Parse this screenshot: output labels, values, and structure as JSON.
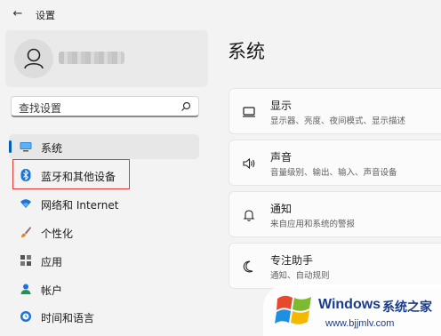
{
  "window": {
    "title": "设置"
  },
  "profile": {
    "name_blurred": ""
  },
  "search": {
    "placeholder": "查找设置"
  },
  "nav": [
    {
      "label": "系统",
      "icon": "monitor-icon",
      "selected": true
    },
    {
      "label": "蓝牙和其他设备",
      "icon": "bluetooth-icon",
      "selected": false
    },
    {
      "label": "网络和 Internet",
      "icon": "wifi-icon",
      "selected": false
    },
    {
      "label": "个性化",
      "icon": "brush-icon",
      "selected": false
    },
    {
      "label": "应用",
      "icon": "apps-icon",
      "selected": false
    },
    {
      "label": "帐户",
      "icon": "person-icon",
      "selected": false
    },
    {
      "label": "时间和语言",
      "icon": "globe-clock-icon",
      "selected": false
    }
  ],
  "main": {
    "title": "系统",
    "cards": [
      {
        "title": "显示",
        "subtitle": "显示器、亮度、夜间模式、显示描述",
        "icon": "display-icon"
      },
      {
        "title": "声音",
        "subtitle": "音量级别、输出、输入、声音设备",
        "icon": "speaker-icon"
      },
      {
        "title": "通知",
        "subtitle": "来自应用和系统的警报",
        "icon": "bell-icon"
      },
      {
        "title": "专注助手",
        "subtitle": "通知、自动规则",
        "icon": "moon-icon"
      }
    ]
  },
  "watermark": {
    "brand": "Windows",
    "cn": "系统之家",
    "url": "www.bjjmlv.com"
  },
  "colors": {
    "accent": "#005fb8",
    "highlight": "#e53935",
    "background": "#f3f3f3"
  }
}
